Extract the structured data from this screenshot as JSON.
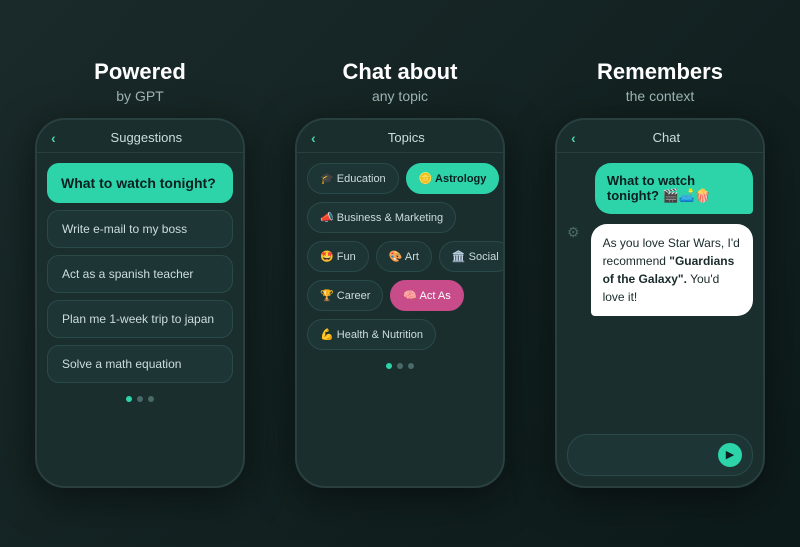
{
  "panel1": {
    "title": "Powered",
    "subtitle": "by GPT",
    "header": "Suggestions",
    "highlight": "What to watch tonight?",
    "items": [
      "Write e-mail to my boss",
      "Act as a spanish teacher",
      "Plan me 1-week trip to japan",
      "Solve a math equation"
    ]
  },
  "panel2": {
    "title": "Chat about",
    "subtitle": "any topic",
    "header": "Topics",
    "topics": [
      {
        "label": "🎓 Education",
        "active": false
      },
      {
        "label": "🪙 Astrology",
        "active": true
      },
      {
        "label": "📣 Business & Marketing",
        "active": false
      },
      {
        "label": "🤩 Fun",
        "active": false
      },
      {
        "label": "🎨 Art",
        "active": false
      },
      {
        "label": "🏛️ Social",
        "active": false
      },
      {
        "label": "🏆 Career",
        "active": false
      },
      {
        "label": "🧠 Act As",
        "active": true,
        "style": "pink"
      },
      {
        "label": "💪 Health & Nutrition",
        "active": false
      }
    ]
  },
  "panel3": {
    "title": "Remembers",
    "subtitle": "the context",
    "header": "Chat",
    "user_message": "What to watch tonight? 🎬🛋️🍿",
    "bot_message": "As you love Star Wars, I'd recommend ",
    "bot_highlight": "\"Guardians of the Galaxy\".",
    "bot_suffix": " You'd love it!",
    "input_placeholder": ""
  }
}
